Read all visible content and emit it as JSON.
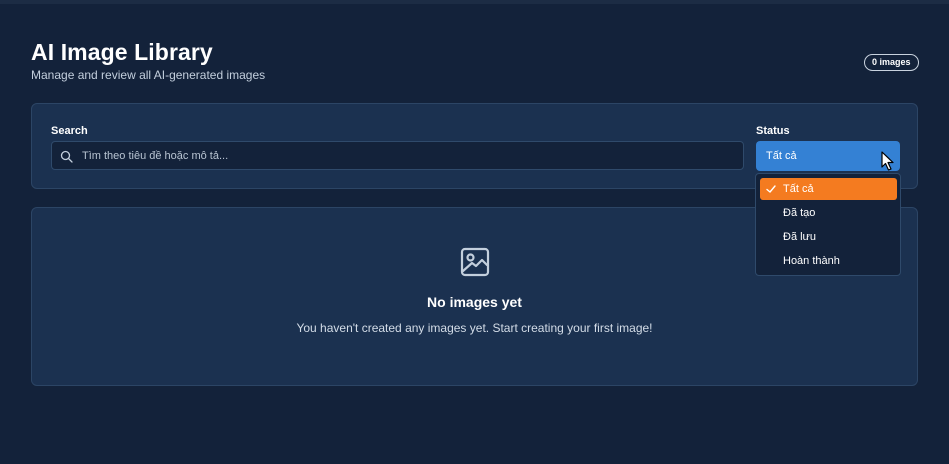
{
  "header": {
    "title": "AI Image Library",
    "subtitle": "Manage and review all AI-generated images",
    "count_badge": "0 images"
  },
  "filters": {
    "search_label": "Search",
    "search_placeholder": "Tìm theo tiêu đề hoặc mô tả...",
    "status_label": "Status",
    "status_value": "Tất cả",
    "status_options": [
      {
        "label": "Tất cả",
        "selected": true
      },
      {
        "label": "Đã tạo",
        "selected": false
      },
      {
        "label": "Đã lưu",
        "selected": false
      },
      {
        "label": "Hoàn thành",
        "selected": false
      }
    ]
  },
  "empty_state": {
    "icon": "image-icon",
    "title": "No images yet",
    "description": "You haven't created any images yet. Start creating your first image!"
  },
  "colors": {
    "background": "#13223a",
    "card": "#1b3150",
    "accent_blue": "#3481d4",
    "selected_orange": "#f47b20"
  }
}
